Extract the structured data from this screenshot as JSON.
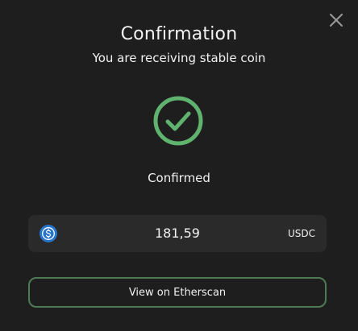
{
  "modal": {
    "title": "Confirmation",
    "subtitle": "You are receiving stable coin",
    "status": "Confirmed",
    "close_icon": "close-icon",
    "success_icon": "check-circle-icon"
  },
  "amount": {
    "value": "181,59",
    "currency": "USDC",
    "coin_icon": "usdc-coin-icon"
  },
  "actions": {
    "etherscan_label": "View on Etherscan"
  },
  "colors": {
    "background": "#1e1e1e",
    "card": "#2a2a2a",
    "success_green": "#5fb36f",
    "button_border": "#4e7a56",
    "usdc_blue": "#2775ca"
  }
}
